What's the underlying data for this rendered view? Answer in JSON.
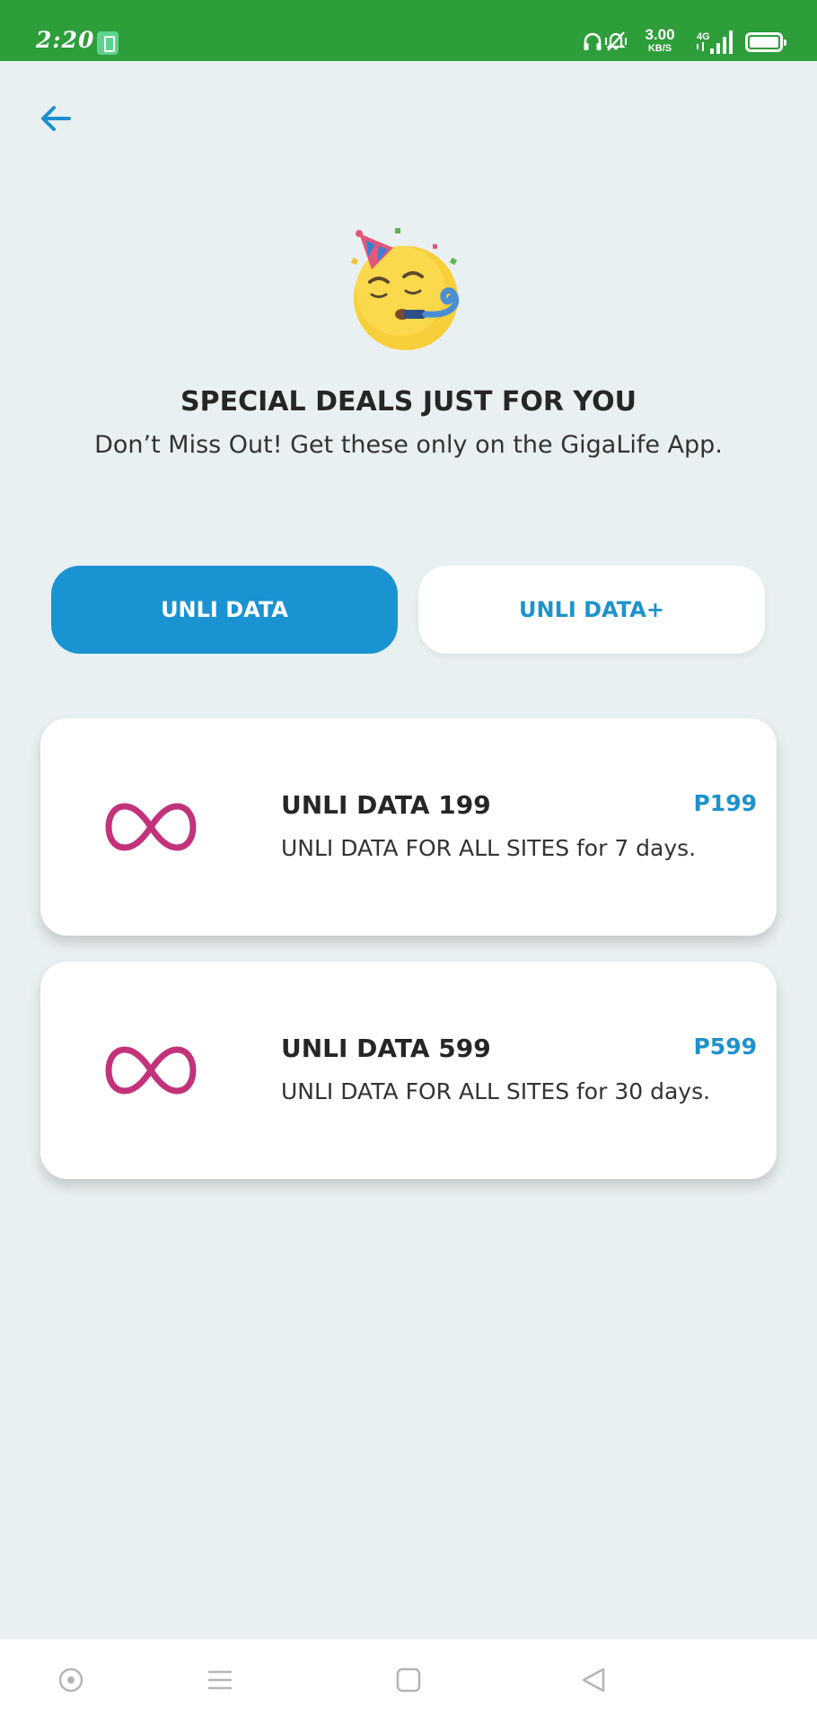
{
  "status_bar": {
    "time": "2:20",
    "net_speed_value": "3.00",
    "net_speed_unit": "KB/S",
    "network_type": "4G"
  },
  "header": {
    "title": "SPECIAL DEALS JUST FOR YOU",
    "subtitle": "Don’t Miss Out! Get these only on the GigaLife App."
  },
  "tabs": [
    {
      "label": "UNLI DATA",
      "active": true
    },
    {
      "label": "UNLI DATA+",
      "active": false
    }
  ],
  "deals": [
    {
      "name": "UNLI DATA 199",
      "description": "UNLI DATA FOR ALL SITES for 7 days.",
      "price": "P199",
      "icon": "infinity-icon"
    },
    {
      "name": "UNLI DATA 599",
      "description": "UNLI DATA FOR ALL SITES for 30 days.",
      "price": "P599",
      "icon": "infinity-icon"
    }
  ],
  "colors": {
    "status_bar": "#2e9e3b",
    "accent": "#1993d2",
    "price": "#1d92cc",
    "infinity": "#c2337b",
    "background": "#e9f0f1"
  },
  "nav_bar": {
    "icons": [
      "assistant-dot-icon",
      "menu-icon",
      "home-square-icon",
      "back-triangle-icon"
    ]
  }
}
